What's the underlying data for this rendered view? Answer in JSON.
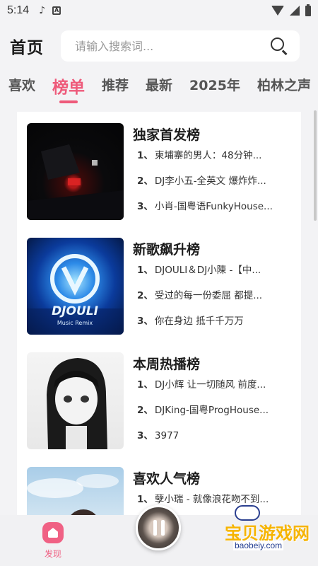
{
  "status_bar": {
    "time": "5:14"
  },
  "header": {
    "title": "首页",
    "search_placeholder": "请输入搜索词..."
  },
  "tabs": [
    {
      "label": "喜欢"
    },
    {
      "label": "榜单"
    },
    {
      "label": "推荐"
    },
    {
      "label": "最新"
    },
    {
      "label": "2025年"
    },
    {
      "label": "柏林之声"
    }
  ],
  "ranks": [
    {
      "name": "独家首发榜",
      "tracks": [
        {
          "num": "1、",
          "text": "柬埔寨的男人：48分钟..."
        },
        {
          "num": "2、",
          "text": "DJ李小五-全英文 爆炸炸..."
        },
        {
          "num": "3、",
          "text": "小肖-国粤语FunkyHouse..."
        }
      ]
    },
    {
      "name": "新歌飙升榜",
      "cover_text": "DJOULI",
      "cover_sub": "Music Remix",
      "tracks": [
        {
          "num": "1、",
          "text": "DJOULI＆DJ小陳 -【中..."
        },
        {
          "num": "2、",
          "text": "受过的每一份委屈 都提..."
        },
        {
          "num": "3、",
          "text": "你在身边 抵千千万万"
        }
      ]
    },
    {
      "name": "本周热播榜",
      "tracks": [
        {
          "num": "1、",
          "text": "DJ小辉 让一切随风 前度..."
        },
        {
          "num": "2、",
          "text": "DJKing-国粤ProgHouse..."
        },
        {
          "num": "3、",
          "text": "3977"
        }
      ]
    },
    {
      "name": "喜欢人气榜",
      "tracks": [
        {
          "num": "1、",
          "text": "孽小瑞 - 就像浪花吻不到..."
        }
      ]
    }
  ],
  "bottom_nav": {
    "discover_label": "发现"
  },
  "watermark": {
    "text": "宝贝游戏网",
    "url": "baobeiy.com"
  },
  "colors": {
    "accent": "#ee5a7a",
    "background": "#f3f3f5"
  }
}
